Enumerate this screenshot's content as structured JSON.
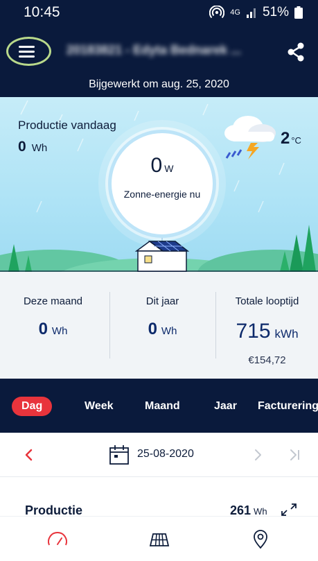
{
  "status_bar": {
    "time": "10:45",
    "network": "4G",
    "battery": "51%"
  },
  "header": {
    "station_title": "20183821 - Edyta Bednarek ...",
    "updated": "Bijgewerkt om aug. 25, 2020",
    "menu_icon": "hamburger-icon",
    "share_icon": "share-icon"
  },
  "hero": {
    "production_today_label": "Productie vandaag",
    "production_today_value": "0",
    "production_today_unit": "Wh",
    "gauge_value": "0",
    "gauge_unit": "W",
    "gauge_label": "Zonne-energie nu",
    "weather_icon": "rain-thunder-cloud-icon",
    "temperature": "2",
    "temperature_unit": "°C"
  },
  "stats": {
    "month_label": "Deze maand",
    "month_value": "0",
    "month_unit": "Wh",
    "year_label": "Dit jaar",
    "year_value": "0",
    "year_unit": "Wh",
    "total_label": "Totale looptijd",
    "total_value": "715",
    "total_unit": "kWh",
    "total_money": "€154,72"
  },
  "tabs": {
    "items": [
      "Dag",
      "Week",
      "Maand",
      "Jaar",
      "Facturering"
    ],
    "active": "Dag"
  },
  "date_nav": {
    "date": "25-08-2020",
    "calendar_icon": "calendar-icon"
  },
  "production": {
    "label": "Productie",
    "value": "261",
    "unit": "Wh",
    "expand_icon": "expand-icon"
  },
  "bottom_nav": {
    "items": [
      "speedometer-icon",
      "solar-panel-icon",
      "location-pin-icon"
    ]
  },
  "colors": {
    "navy": "#0a1a3c",
    "accent_red": "#e8343c",
    "sky": "#aee3f6",
    "highlight_ring": "#b9d98b"
  }
}
